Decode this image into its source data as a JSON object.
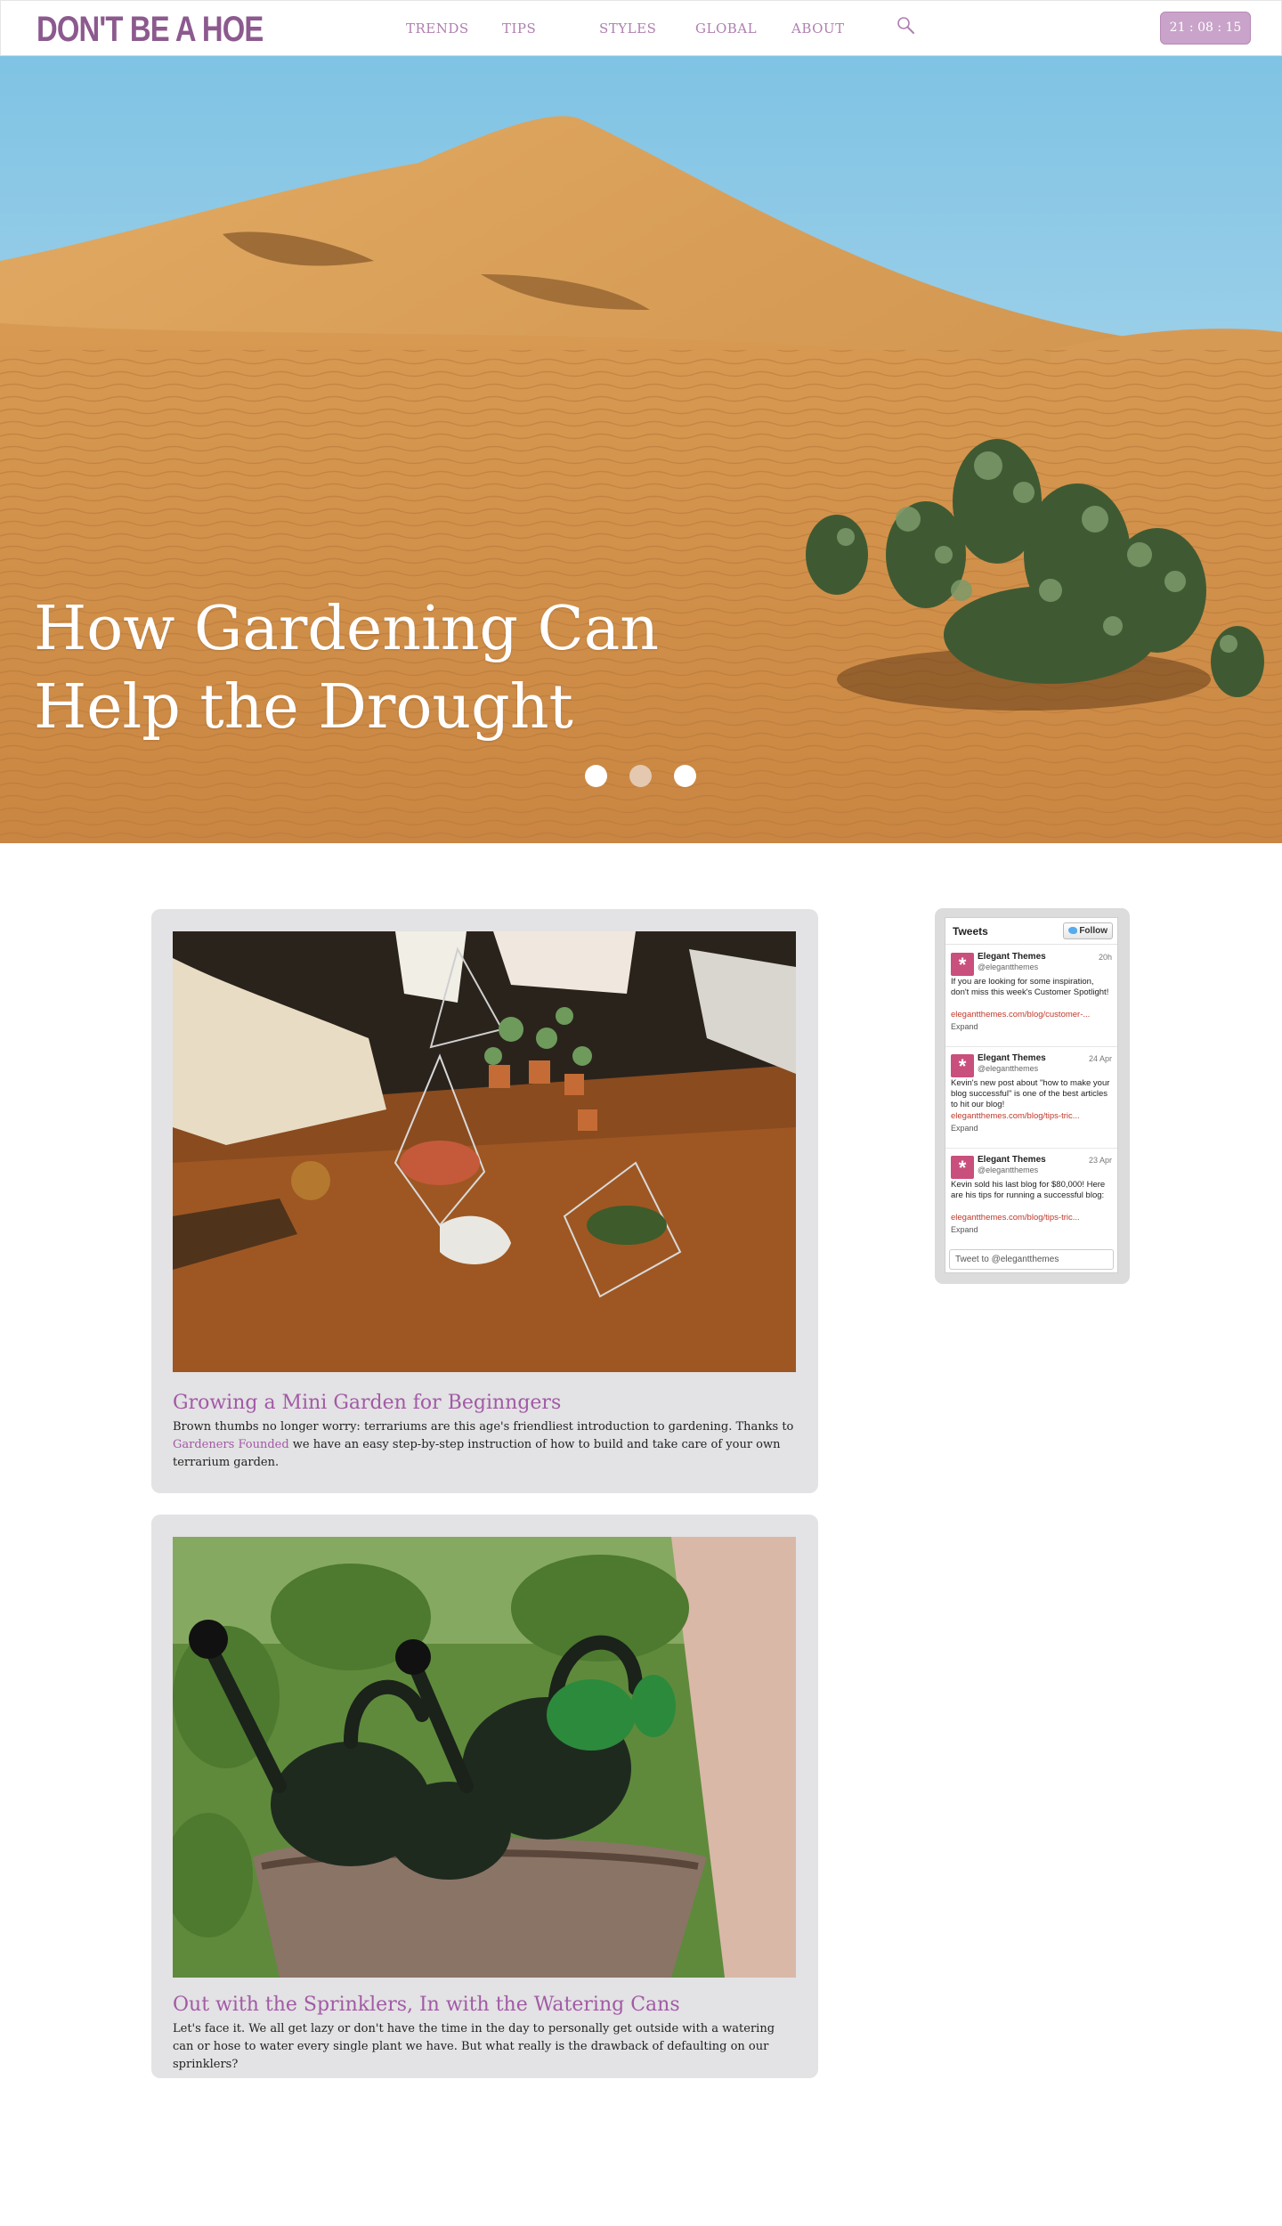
{
  "header": {
    "logo": "DON'T BE A HOE",
    "nav": [
      {
        "label": "TRENDS",
        "name": "nav-trends"
      },
      {
        "label": "TIPS",
        "name": "nav-tips"
      },
      {
        "label": "STYLES",
        "name": "nav-styles"
      },
      {
        "label": "GLOBAL",
        "name": "nav-global"
      },
      {
        "label": "ABOUT",
        "name": "nav-about"
      }
    ],
    "search_icon": "search-icon",
    "clock": "21 : 08 : 15"
  },
  "hero": {
    "title_line1": "How Gardening Can",
    "title_line2": "Help the Drought",
    "slides": 3,
    "active_slide": 2
  },
  "posts": [
    {
      "title": "Growing a Mini Garden for Beginngers",
      "text_before_link": "Brown thumbs no longer worry: terrariums are this age's friendliest introduction to gardening. Thanks to ",
      "link": "Gardeners Founded",
      "text_after_link": " we have an easy step-by-step instruction of how to build and take care of your own terrarium garden."
    },
    {
      "title": "Out with the Sprinklers, In with the Watering Cans",
      "text": "Let's face it. We all get lazy or don't have the time in the day to personally get outside with a watering can or hose to water every single plant we have. But what really is the drawback of defaulting on our sprinklers?"
    }
  ],
  "tweets_widget": {
    "title": "Tweets",
    "follow": "Follow",
    "compose_placeholder": "Tweet to @elegantthemes",
    "tweets": [
      {
        "name": "Elegant Themes",
        "handle": "@elegantthemes",
        "time": "20h",
        "text": "If you are looking for some inspiration, don't miss this week's Customer Spotlight!",
        "link": "elegantthemes.com/blog/customer-...",
        "expand": "Expand"
      },
      {
        "name": "Elegant Themes",
        "handle": "@elegantthemes",
        "time": "24 Apr",
        "text": "Kevin's new post about \"how to make your blog successful\" is one of the best articles to hit our blog!",
        "link": "elegantthemes.com/blog/tips-tric...",
        "expand": "Expand"
      },
      {
        "name": "Elegant Themes",
        "handle": "@elegantthemes",
        "time": "23 Apr",
        "text": "Kevin sold his last blog for $80,000! Here are his tips for running a successful blog:",
        "link": "elegantthemes.com/blog/tips-tric...",
        "expand": "Expand"
      }
    ]
  },
  "colors": {
    "brand": "#8c5a8f",
    "nav": "#b07fb0",
    "link": "#a25aa6",
    "clock_bg": "#c9a3c9",
    "card_bg": "#e3e2e4"
  }
}
